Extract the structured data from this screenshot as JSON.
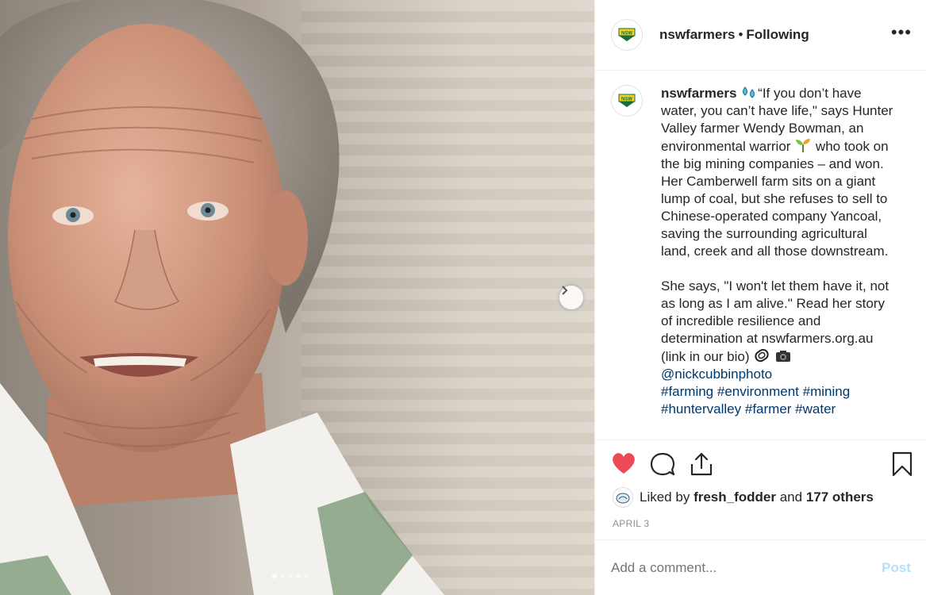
{
  "post": {
    "account": {
      "handle": "nswfarmers",
      "separator": "•",
      "follow_status": "Following",
      "avatar_text": "NSW",
      "more_glyph": "•••"
    },
    "caption": {
      "handle": "nswfarmers",
      "line1": "“If you don’t have water, you can’t have life,\" says Hunter Valley farmer Wendy Bowman, an environmental warrior ",
      "line1b": " who took on the big mining companies – and won.",
      "para2": "Her Camberwell farm sits on a giant lump of coal, but she refuses to sell to Chinese-operated company Yancoal, saving the surrounding agricultural land, creek and all those downstream.",
      "para3": "She says, \"I won't let them have it, not as long as I am alive.\" Read her story of incredible resilience and determination at nswfarmers.org.au (link in our bio) ",
      "mention": "@nickcubbinphoto",
      "hashtags": [
        "#farming",
        "#environment",
        "#mining",
        "#huntervalley",
        "#farmer",
        "#water"
      ]
    },
    "likes": {
      "liker": "fresh_fodder",
      "others_count": "177 others",
      "prefix": "Liked by",
      "joiner": "and"
    },
    "date": "APRIL 3",
    "comment": {
      "placeholder": "Add a comment...",
      "post_label": "Post"
    },
    "carousel": {
      "slides": 5,
      "active_index": 0
    },
    "colors": {
      "like_red": "#ed4956",
      "link_blue": "#00376b",
      "post_disabled": "#b2dffc"
    }
  }
}
